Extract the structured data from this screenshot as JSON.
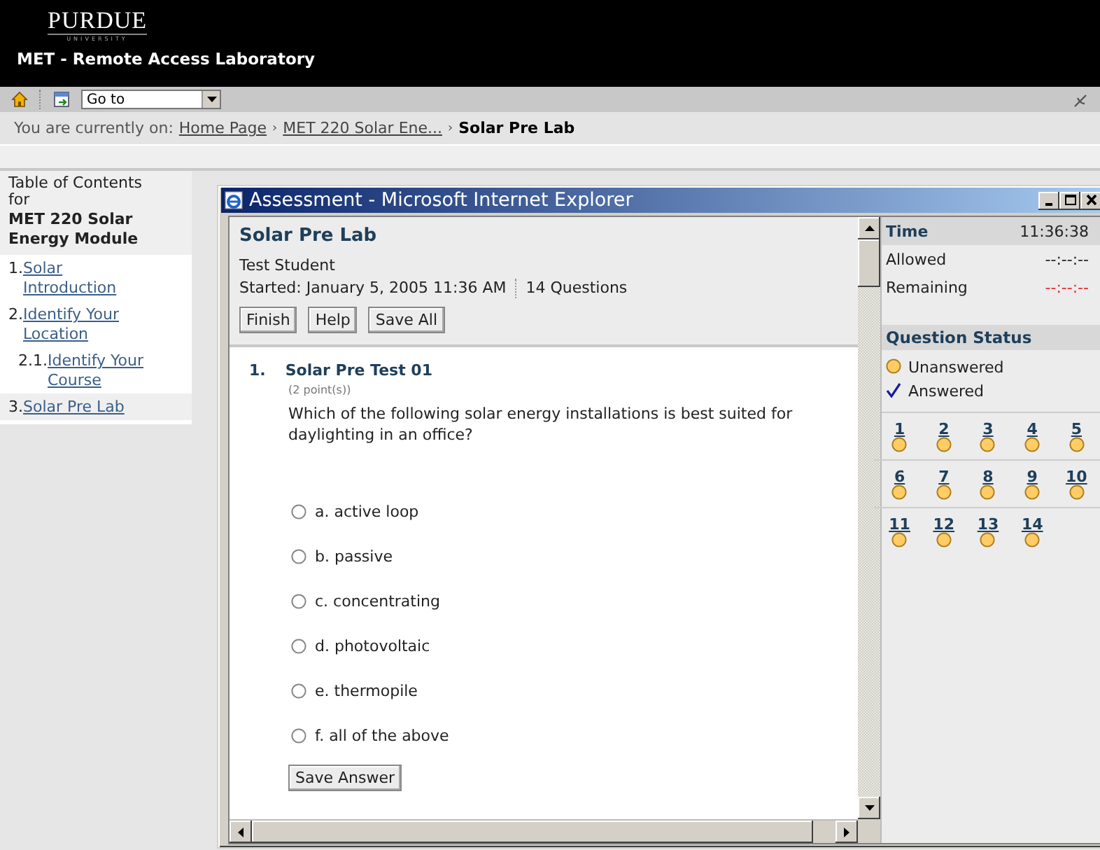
{
  "header": {
    "logo": "PURDUE",
    "logo_sub": "UNIVERSITY",
    "title": "MET - Remote Access Laboratory"
  },
  "toolbar": {
    "goto": "Go to"
  },
  "breadcrumb": {
    "prefix": "You are currently on:",
    "items": [
      {
        "kind": "link",
        "label": "Home Page"
      },
      {
        "kind": "separator",
        "label": "›"
      },
      {
        "kind": "link",
        "label": "MET 220 Solar Ene..."
      },
      {
        "kind": "separator",
        "label": "›"
      },
      {
        "kind": "current",
        "label": "Solar Pre Lab"
      }
    ]
  },
  "toc": {
    "heading": "Table of Contents for",
    "course": "MET 220 Solar Energy Module",
    "items": [
      {
        "number": "1.",
        "label": "Solar Introduction",
        "selected": false
      },
      {
        "number": "2.",
        "label": "Identify Your Location",
        "selected": false,
        "children": [
          {
            "number": "2.1.",
            "label": "Identify Your Course",
            "selected": false
          }
        ]
      },
      {
        "number": "3.",
        "label": "Solar Pre Lab",
        "selected": true
      }
    ]
  },
  "window": {
    "title": "Assessment - Microsoft Internet Explorer"
  },
  "assessment": {
    "title": "Solar Pre Lab",
    "student": "Test Student",
    "started": "Started: January 5, 2005 11:36 AM",
    "count": "14 Questions",
    "buttons": [
      "Finish",
      "Help",
      "Save All"
    ],
    "question": {
      "number": "1.",
      "title": "Solar Pre Test 01",
      "points": "(2 point(s))",
      "text": "Which of the following solar energy installations is best suited for daylighting in an office?",
      "options": [
        {
          "label": "a. active loop",
          "selected": false
        },
        {
          "label": "b. passive",
          "selected": false
        },
        {
          "label": "c. concentrating",
          "selected": false
        },
        {
          "label": "d. photovoltaic",
          "selected": false
        },
        {
          "label": "e. thermopile",
          "selected": false
        },
        {
          "label": "f. all of the above",
          "selected": false
        }
      ],
      "save": "Save Answer"
    }
  },
  "status": {
    "time": [
      {
        "kind": "header",
        "label": "Time",
        "value": "11:36:38"
      },
      {
        "kind": "normal",
        "label": "Allowed",
        "value": "--:--:--"
      },
      {
        "kind": "warning",
        "label": "Remaining",
        "value": "--:--:--"
      }
    ],
    "heading": "Question Status",
    "legend": [
      {
        "answered": false,
        "label": "Unanswered"
      },
      {
        "answered": true,
        "label": "Answered"
      }
    ],
    "questions": [
      {
        "label": "1",
        "answered": false
      },
      {
        "label": "2",
        "answered": false
      },
      {
        "label": "3",
        "answered": false
      },
      {
        "label": "4",
        "answered": false
      },
      {
        "label": "5",
        "answered": false
      },
      {
        "label": "6",
        "answered": false
      },
      {
        "label": "7",
        "answered": false
      },
      {
        "label": "8",
        "answered": false
      },
      {
        "label": "9",
        "answered": false
      },
      {
        "label": "10",
        "answered": false
      },
      {
        "label": "11",
        "answered": false
      },
      {
        "label": "12",
        "answered": false
      },
      {
        "label": "13",
        "answered": false
      },
      {
        "label": "14",
        "answered": false
      }
    ]
  }
}
